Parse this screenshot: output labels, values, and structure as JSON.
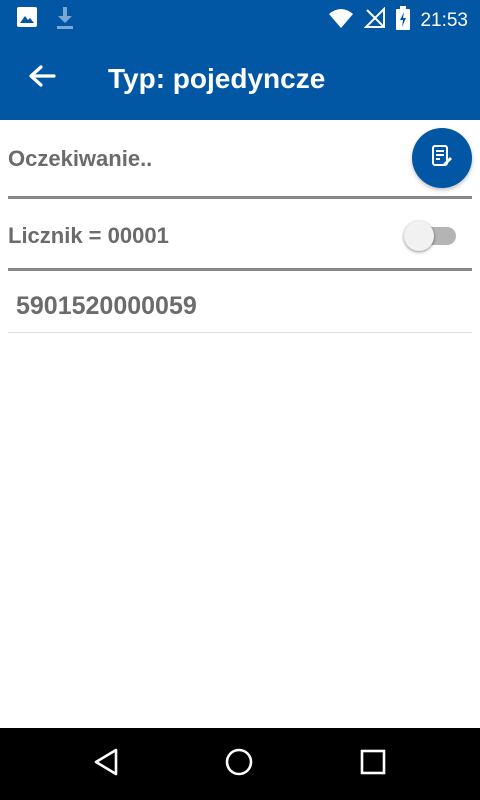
{
  "status_bar": {
    "time": "21:53",
    "icons_left": [
      "image-icon",
      "download-icon"
    ],
    "icons_right": [
      "wifi-icon",
      "no-signal-icon",
      "battery-charging-icon"
    ]
  },
  "app_bar": {
    "title": "Typ: pojedyncze",
    "back_icon": "arrow-left-icon",
    "color": "#0257a5"
  },
  "main": {
    "status_label": "Oczekiwanie..",
    "counter_label": "Licznik = 00001",
    "counter_toggle_on": false,
    "edit_icon": "edit-document-icon",
    "code_value": "5901520000059"
  },
  "nav_bar": {
    "buttons": [
      "back-triangle-icon",
      "home-circle-icon",
      "recents-square-icon"
    ]
  }
}
